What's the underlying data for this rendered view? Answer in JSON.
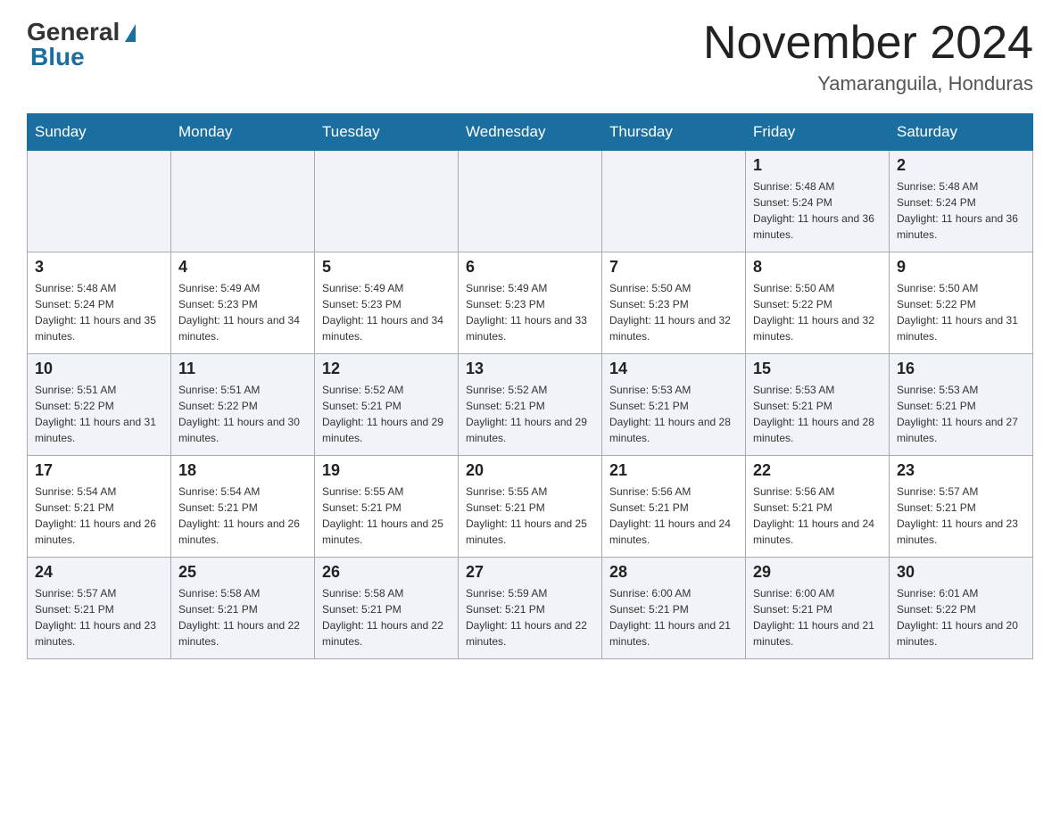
{
  "header": {
    "title": "November 2024",
    "location": "Yamaranguila, Honduras",
    "logo_general": "General",
    "logo_blue": "Blue"
  },
  "weekdays": [
    "Sunday",
    "Monday",
    "Tuesday",
    "Wednesday",
    "Thursday",
    "Friday",
    "Saturday"
  ],
  "weeks": [
    {
      "days": [
        {
          "number": "",
          "info": ""
        },
        {
          "number": "",
          "info": ""
        },
        {
          "number": "",
          "info": ""
        },
        {
          "number": "",
          "info": ""
        },
        {
          "number": "",
          "info": ""
        },
        {
          "number": "1",
          "info": "Sunrise: 5:48 AM\nSunset: 5:24 PM\nDaylight: 11 hours and 36 minutes."
        },
        {
          "number": "2",
          "info": "Sunrise: 5:48 AM\nSunset: 5:24 PM\nDaylight: 11 hours and 36 minutes."
        }
      ]
    },
    {
      "days": [
        {
          "number": "3",
          "info": "Sunrise: 5:48 AM\nSunset: 5:24 PM\nDaylight: 11 hours and 35 minutes."
        },
        {
          "number": "4",
          "info": "Sunrise: 5:49 AM\nSunset: 5:23 PM\nDaylight: 11 hours and 34 minutes."
        },
        {
          "number": "5",
          "info": "Sunrise: 5:49 AM\nSunset: 5:23 PM\nDaylight: 11 hours and 34 minutes."
        },
        {
          "number": "6",
          "info": "Sunrise: 5:49 AM\nSunset: 5:23 PM\nDaylight: 11 hours and 33 minutes."
        },
        {
          "number": "7",
          "info": "Sunrise: 5:50 AM\nSunset: 5:23 PM\nDaylight: 11 hours and 32 minutes."
        },
        {
          "number": "8",
          "info": "Sunrise: 5:50 AM\nSunset: 5:22 PM\nDaylight: 11 hours and 32 minutes."
        },
        {
          "number": "9",
          "info": "Sunrise: 5:50 AM\nSunset: 5:22 PM\nDaylight: 11 hours and 31 minutes."
        }
      ]
    },
    {
      "days": [
        {
          "number": "10",
          "info": "Sunrise: 5:51 AM\nSunset: 5:22 PM\nDaylight: 11 hours and 31 minutes."
        },
        {
          "number": "11",
          "info": "Sunrise: 5:51 AM\nSunset: 5:22 PM\nDaylight: 11 hours and 30 minutes."
        },
        {
          "number": "12",
          "info": "Sunrise: 5:52 AM\nSunset: 5:21 PM\nDaylight: 11 hours and 29 minutes."
        },
        {
          "number": "13",
          "info": "Sunrise: 5:52 AM\nSunset: 5:21 PM\nDaylight: 11 hours and 29 minutes."
        },
        {
          "number": "14",
          "info": "Sunrise: 5:53 AM\nSunset: 5:21 PM\nDaylight: 11 hours and 28 minutes."
        },
        {
          "number": "15",
          "info": "Sunrise: 5:53 AM\nSunset: 5:21 PM\nDaylight: 11 hours and 28 minutes."
        },
        {
          "number": "16",
          "info": "Sunrise: 5:53 AM\nSunset: 5:21 PM\nDaylight: 11 hours and 27 minutes."
        }
      ]
    },
    {
      "days": [
        {
          "number": "17",
          "info": "Sunrise: 5:54 AM\nSunset: 5:21 PM\nDaylight: 11 hours and 26 minutes."
        },
        {
          "number": "18",
          "info": "Sunrise: 5:54 AM\nSunset: 5:21 PM\nDaylight: 11 hours and 26 minutes."
        },
        {
          "number": "19",
          "info": "Sunrise: 5:55 AM\nSunset: 5:21 PM\nDaylight: 11 hours and 25 minutes."
        },
        {
          "number": "20",
          "info": "Sunrise: 5:55 AM\nSunset: 5:21 PM\nDaylight: 11 hours and 25 minutes."
        },
        {
          "number": "21",
          "info": "Sunrise: 5:56 AM\nSunset: 5:21 PM\nDaylight: 11 hours and 24 minutes."
        },
        {
          "number": "22",
          "info": "Sunrise: 5:56 AM\nSunset: 5:21 PM\nDaylight: 11 hours and 24 minutes."
        },
        {
          "number": "23",
          "info": "Sunrise: 5:57 AM\nSunset: 5:21 PM\nDaylight: 11 hours and 23 minutes."
        }
      ]
    },
    {
      "days": [
        {
          "number": "24",
          "info": "Sunrise: 5:57 AM\nSunset: 5:21 PM\nDaylight: 11 hours and 23 minutes."
        },
        {
          "number": "25",
          "info": "Sunrise: 5:58 AM\nSunset: 5:21 PM\nDaylight: 11 hours and 22 minutes."
        },
        {
          "number": "26",
          "info": "Sunrise: 5:58 AM\nSunset: 5:21 PM\nDaylight: 11 hours and 22 minutes."
        },
        {
          "number": "27",
          "info": "Sunrise: 5:59 AM\nSunset: 5:21 PM\nDaylight: 11 hours and 22 minutes."
        },
        {
          "number": "28",
          "info": "Sunrise: 6:00 AM\nSunset: 5:21 PM\nDaylight: 11 hours and 21 minutes."
        },
        {
          "number": "29",
          "info": "Sunrise: 6:00 AM\nSunset: 5:21 PM\nDaylight: 11 hours and 21 minutes."
        },
        {
          "number": "30",
          "info": "Sunrise: 6:01 AM\nSunset: 5:22 PM\nDaylight: 11 hours and 20 minutes."
        }
      ]
    }
  ]
}
